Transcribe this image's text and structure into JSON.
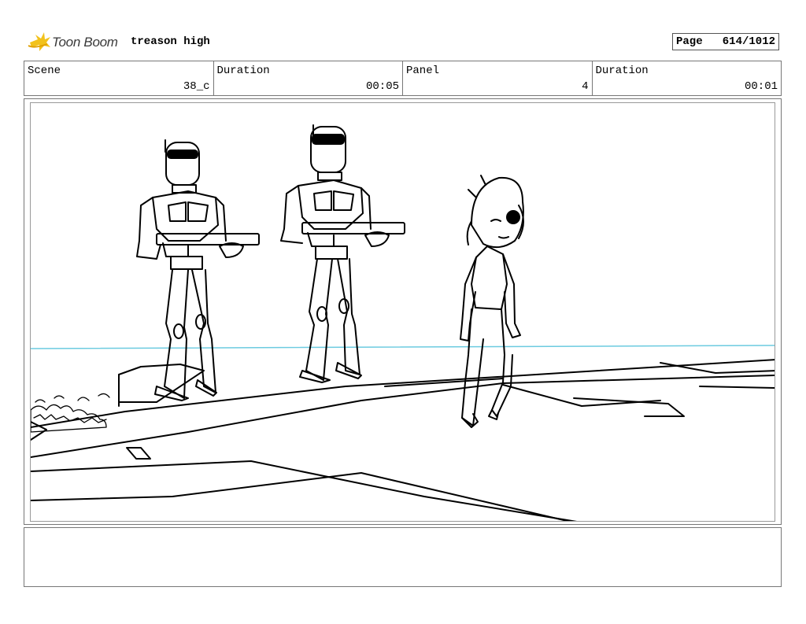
{
  "header": {
    "logo_text": "Toon Boom",
    "project_title": "treason high",
    "page_label": "Page",
    "page_value": "614/1012"
  },
  "info": {
    "scene_label": "Scene",
    "scene_value": "38_c",
    "scene_duration_label": "Duration",
    "scene_duration_value": "00:05",
    "panel_label": "Panel",
    "panel_value": "4",
    "panel_duration_label": "Duration",
    "panel_duration_value": "00:01"
  },
  "panel": {
    "horizon_color": "#6ccbe0"
  },
  "notes": {
    "text": ""
  }
}
